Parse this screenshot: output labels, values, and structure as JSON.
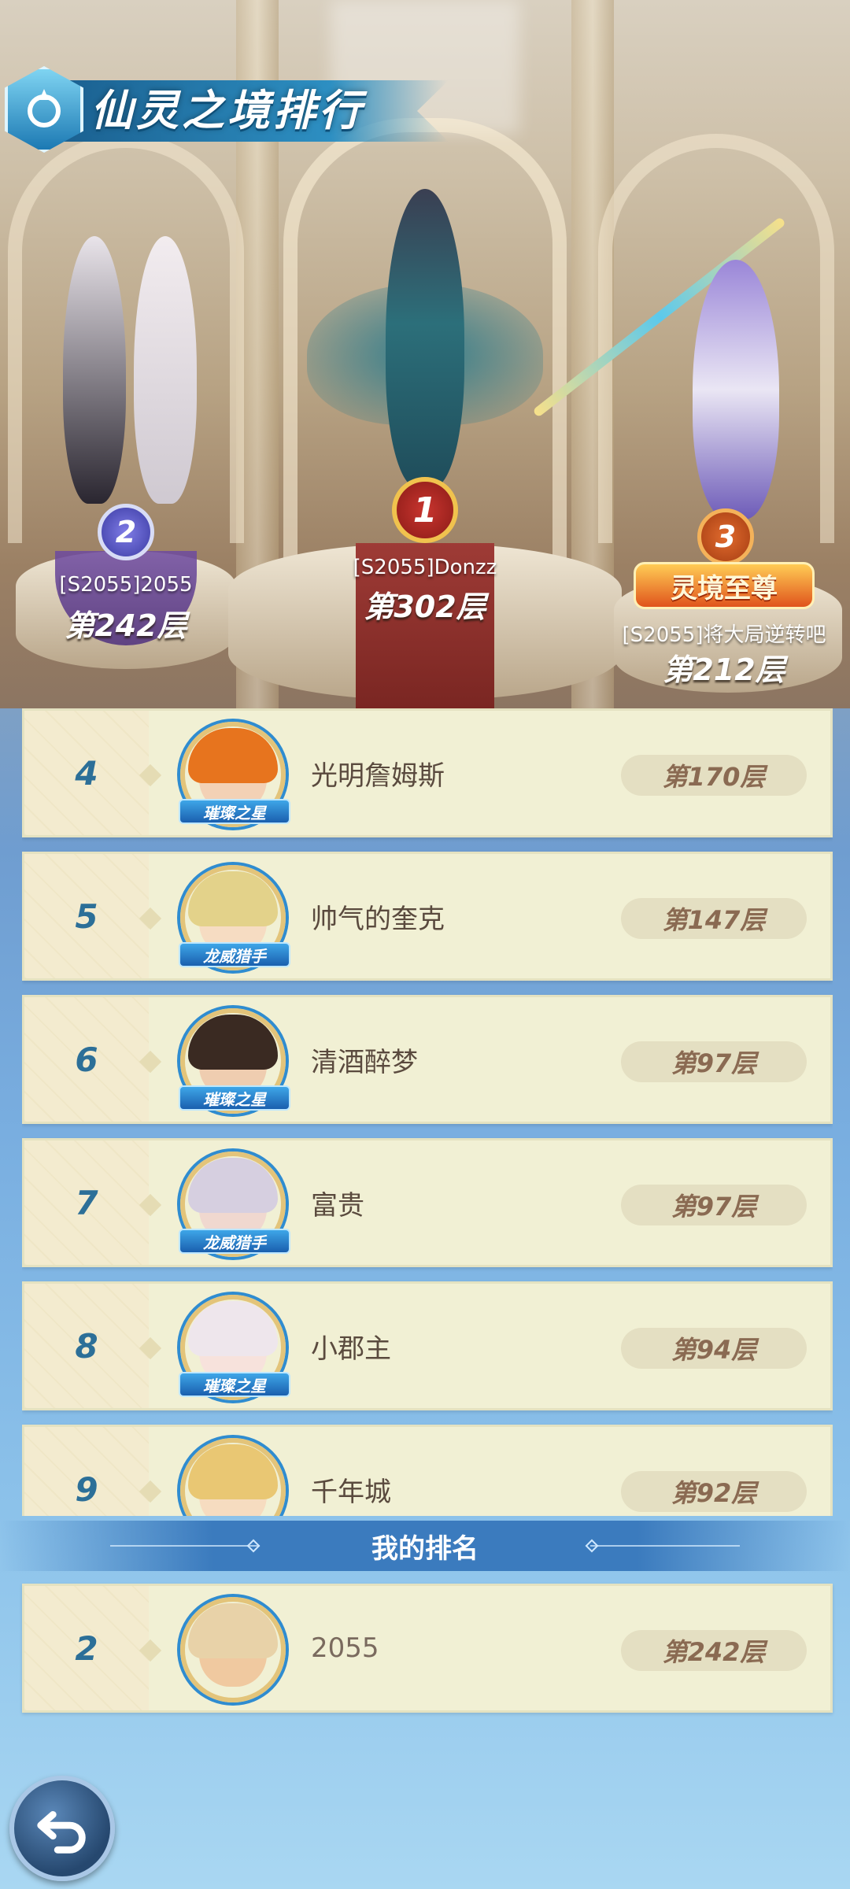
{
  "header": {
    "title": "仙灵之境排行",
    "emblem_icon": "spirit-crest-icon"
  },
  "podium": [
    {
      "rank": "1",
      "name": "[S2055]Donzz",
      "floor": "第302层",
      "badge_color": "#c9352f"
    },
    {
      "rank": "2",
      "name": "[S2055]2055",
      "floor": "第242层",
      "badge_color": "#5553c4"
    },
    {
      "rank": "3",
      "name": "[S2055]将大局逆转吧",
      "floor": "第212层",
      "badge_color": "#e16b2e",
      "title": "灵境至尊"
    }
  ],
  "list": [
    {
      "rank": "4",
      "name": "光明詹姆斯",
      "floor": "第170层",
      "tag": "璀璨之星"
    },
    {
      "rank": "5",
      "name": "帅气的奎克",
      "floor": "第147层",
      "tag": "龙威猎手"
    },
    {
      "rank": "6",
      "name": "清酒醉梦",
      "floor": "第97层",
      "tag": "璀璨之星"
    },
    {
      "rank": "7",
      "name": "富贵",
      "floor": "第97层",
      "tag": "龙威猎手"
    },
    {
      "rank": "8",
      "name": "小郡主",
      "floor": "第94层",
      "tag": "璀璨之星"
    },
    {
      "rank": "9",
      "name": "千年城",
      "floor": "第92层",
      "tag": ""
    }
  ],
  "my_rank": {
    "section_title": "我的排名",
    "rank": "2",
    "name": "2055",
    "floor": "第242层"
  },
  "back_button": {
    "icon": "back-arrow-icon"
  },
  "colors": {
    "rank_number": "#2c6f98",
    "row_bg": "#f1f0d4",
    "floor_text": "#8a6a52",
    "accent_blue": "#2d8fc2"
  }
}
